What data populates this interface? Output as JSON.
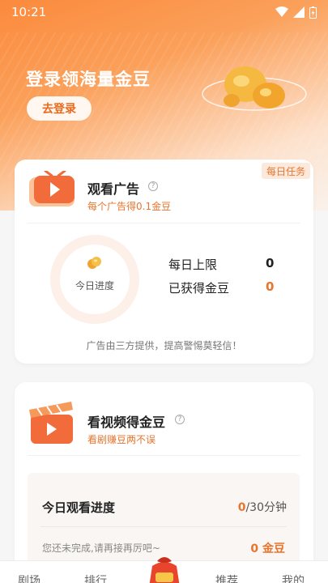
{
  "status_bar": {
    "time": "10:21"
  },
  "hero": {
    "title": "登录领海量金豆",
    "login_button": "去登录"
  },
  "ad_card": {
    "daily_tag": "每日任务",
    "title": "观看广告",
    "help": "?",
    "subtitle": "每个广告得0.1金豆",
    "ring_label": "今日进度",
    "daily_limit_label": "每日上限",
    "daily_limit_value": "0",
    "earned_label": "已获得金豆",
    "earned_value": "0",
    "disclaimer": "广告由三方提供，提高警惕莫轻信！"
  },
  "video_card": {
    "title": "看视频得金豆",
    "help": "?",
    "subtitle": "看剧赚豆两不误",
    "progress_title": "今日观看进度",
    "progress_current": "0",
    "progress_total": "/30分钟",
    "note": "您还未完成,请再接再厉吧~",
    "reward": "0 金豆"
  },
  "bottom_nav": {
    "items": [
      "剧场",
      "排行",
      "推荐",
      "我的"
    ]
  },
  "colors": {
    "accent": "#e8752e",
    "hero_orange": "#fb8a3c"
  }
}
